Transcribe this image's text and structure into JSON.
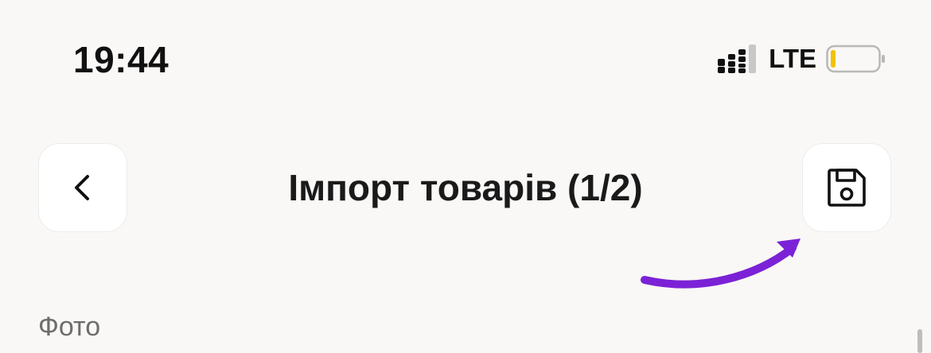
{
  "status_bar": {
    "time": "19:44",
    "network": "LTE",
    "battery_color": "#f2c200"
  },
  "header": {
    "title": "Імпорт товарів (1/2)",
    "back_icon": "chevron-left-icon",
    "save_icon": "floppy-disk-icon"
  },
  "annotation": {
    "arrow_color": "#7b22d6"
  },
  "section": {
    "label": "Фото"
  }
}
